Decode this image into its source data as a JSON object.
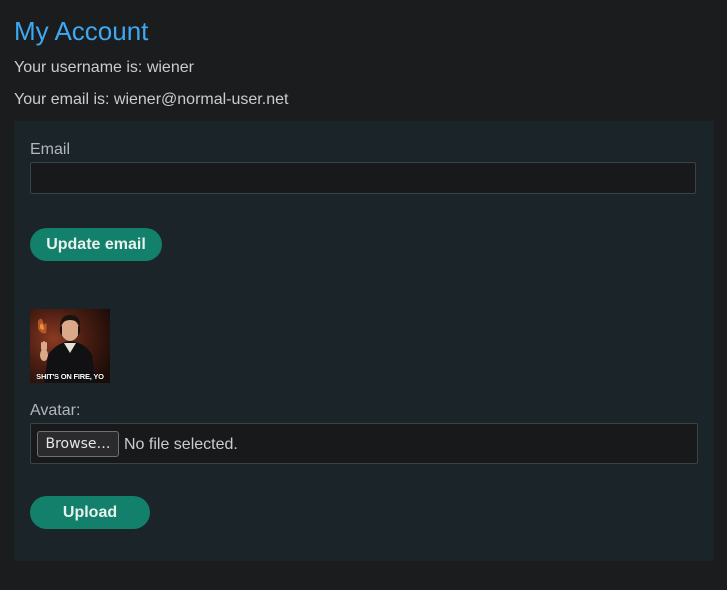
{
  "page": {
    "title": "My Account",
    "username_text": "Your username is: wiener",
    "email_text": "Your email is: wiener@normal-user.net"
  },
  "email_form": {
    "label": "Email",
    "value": "",
    "button_label": "Update email"
  },
  "avatar": {
    "image_caption": "SHIT'S ON FIRE, YO",
    "label": "Avatar:",
    "browse_label": "Browse…",
    "file_status": "No file selected.",
    "button_label": "Upload"
  },
  "colors": {
    "background": "#1b1c1d",
    "panel": "#1b2529",
    "title_accent": "#3ea8f2",
    "button": "#12806a"
  }
}
